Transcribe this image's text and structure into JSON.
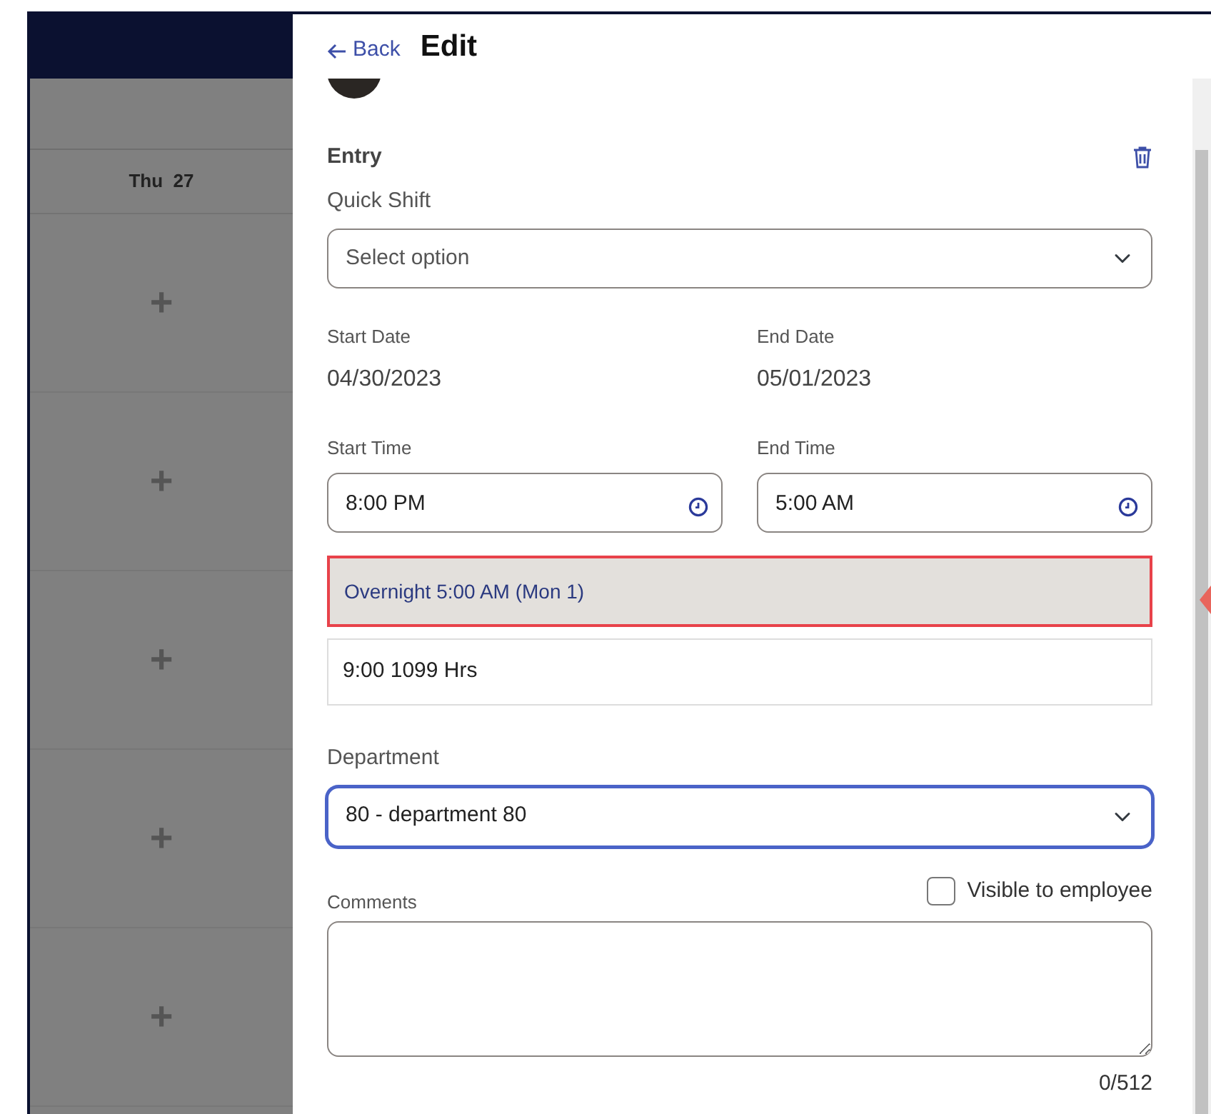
{
  "header": {
    "back_label": "Back",
    "title": "Edit"
  },
  "calendar": {
    "day_header": "Thu  27",
    "cells": [
      {
        "add_label": "+"
      },
      {
        "add_label": "+"
      },
      {
        "add_label": "+"
      },
      {
        "add_label": "+"
      },
      {
        "add_label": "+"
      }
    ]
  },
  "entry": {
    "heading": "Entry",
    "quick_shift": {
      "label": "Quick Shift",
      "placeholder": "Select option"
    },
    "start_date": {
      "label": "Start Date",
      "value": "04/30/2023"
    },
    "end_date": {
      "label": "End Date",
      "value": "05/01/2023"
    },
    "start_time": {
      "label": "Start Time",
      "value": "8:00 PM"
    },
    "end_time": {
      "label": "End Time",
      "value": "5:00 AM"
    },
    "overnight_notice": {
      "text": "Overnight 5:00 AM (Mon 1)",
      "highlighted": true
    },
    "hours": "9:00 1099 Hrs",
    "department": {
      "label": "Department",
      "value": "80 - department 80",
      "focused": true
    },
    "visible_to_employee": {
      "label": "Visible to employee",
      "checked": false
    },
    "comments": {
      "label": "Comments",
      "counter": "0/512"
    }
  }
}
